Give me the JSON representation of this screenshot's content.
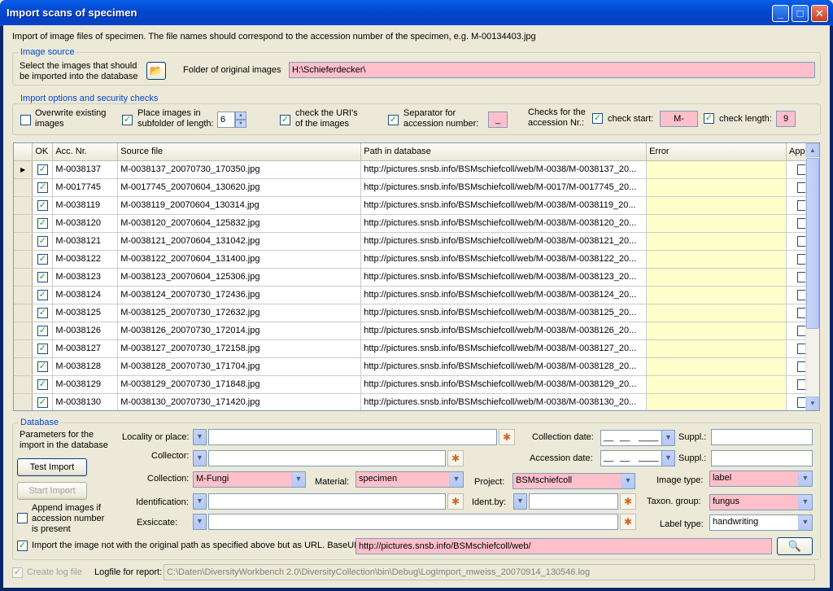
{
  "window": {
    "title": "Import scans of specimen",
    "minimize_glyph": "_",
    "maximize_glyph": "□",
    "close_glyph": "✕"
  },
  "intro": "Import of image files of specimen. The file names should correspond to the accession number of the specimen, e.g. M-00134403.jpg",
  "image_source": {
    "group_title": "Image source",
    "hint_line1": "Select the images that should",
    "hint_line2": "be imported into the database",
    "folder_icon": "folder-open-icon",
    "folder_label": "Folder of original images",
    "folder_value": "H:\\Schieferdecker\\"
  },
  "options": {
    "group_title": "Import options and security checks",
    "overwrite_line1": "Overwrite existing",
    "overwrite_line2": "images",
    "overwrite_checked": false,
    "subfolder_line1": "Place images in",
    "subfolder_line2": "subfolder of length:",
    "subfolder_checked": true,
    "subfolder_length": "6",
    "check_uri_line1": "check the URI's",
    "check_uri_line2": "of the images",
    "check_uri_checked": true,
    "separator_line1": "Separator for",
    "separator_line2": "accession number:",
    "separator_checked": true,
    "separator_value": "_",
    "checks_line1": "Checks for the",
    "checks_line2": "accession Nr.:",
    "check_start_label": "check start:",
    "check_start_checked": true,
    "check_start_value": "M-",
    "check_length_label": "check length:",
    "check_length_checked": true,
    "check_length_value": "9"
  },
  "grid": {
    "columns": [
      "OK",
      "Acc. Nr.",
      "Source file",
      "Path in database",
      "Error",
      "App"
    ],
    "rows": [
      {
        "ok": true,
        "acc": "M-0038137",
        "src": "M-0038137_20070730_170350.jpg",
        "path": "http://pictures.snsb.info/BSMschiefcoll/web/M-0038/M-0038137_20...",
        "error": "",
        "app": false
      },
      {
        "ok": true,
        "acc": "M-0017745",
        "src": "M-0017745_20070604_130620.jpg",
        "path": "http://pictures.snsb.info/BSMschiefcoll/web/M-0017/M-0017745_20...",
        "error": "",
        "app": false
      },
      {
        "ok": true,
        "acc": "M-0038119",
        "src": "M-0038119_20070604_130314.jpg",
        "path": "http://pictures.snsb.info/BSMschiefcoll/web/M-0038/M-0038119_20...",
        "error": "",
        "app": false
      },
      {
        "ok": true,
        "acc": "M-0038120",
        "src": "M-0038120_20070604_125832.jpg",
        "path": "http://pictures.snsb.info/BSMschiefcoll/web/M-0038/M-0038120_20...",
        "error": "",
        "app": false
      },
      {
        "ok": true,
        "acc": "M-0038121",
        "src": "M-0038121_20070604_131042.jpg",
        "path": "http://pictures.snsb.info/BSMschiefcoll/web/M-0038/M-0038121_20...",
        "error": "",
        "app": false
      },
      {
        "ok": true,
        "acc": "M-0038122",
        "src": "M-0038122_20070604_131400.jpg",
        "path": "http://pictures.snsb.info/BSMschiefcoll/web/M-0038/M-0038122_20...",
        "error": "",
        "app": false
      },
      {
        "ok": true,
        "acc": "M-0038123",
        "src": "M-0038123_20070604_125306.jpg",
        "path": "http://pictures.snsb.info/BSMschiefcoll/web/M-0038/M-0038123_20...",
        "error": "",
        "app": false
      },
      {
        "ok": true,
        "acc": "M-0038124",
        "src": "M-0038124_20070730_172436.jpg",
        "path": "http://pictures.snsb.info/BSMschiefcoll/web/M-0038/M-0038124_20...",
        "error": "",
        "app": false
      },
      {
        "ok": true,
        "acc": "M-0038125",
        "src": "M-0038125_20070730_172632.jpg",
        "path": "http://pictures.snsb.info/BSMschiefcoll/web/M-0038/M-0038125_20...",
        "error": "",
        "app": false
      },
      {
        "ok": true,
        "acc": "M-0038126",
        "src": "M-0038126_20070730_172014.jpg",
        "path": "http://pictures.snsb.info/BSMschiefcoll/web/M-0038/M-0038126_20...",
        "error": "",
        "app": false
      },
      {
        "ok": true,
        "acc": "M-0038127",
        "src": "M-0038127_20070730_172158.jpg",
        "path": "http://pictures.snsb.info/BSMschiefcoll/web/M-0038/M-0038127_20...",
        "error": "",
        "app": false
      },
      {
        "ok": true,
        "acc": "M-0038128",
        "src": "M-0038128_20070730_171704.jpg",
        "path": "http://pictures.snsb.info/BSMschiefcoll/web/M-0038/M-0038128_20...",
        "error": "",
        "app": false
      },
      {
        "ok": true,
        "acc": "M-0038129",
        "src": "M-0038129_20070730_171848.jpg",
        "path": "http://pictures.snsb.info/BSMschiefcoll/web/M-0038/M-0038129_20...",
        "error": "",
        "app": false
      },
      {
        "ok": true,
        "acc": "M-0038130",
        "src": "M-0038130_20070730_171420.jpg",
        "path": "http://pictures.snsb.info/BSMschiefcoll/web/M-0038/M-0038130_20...",
        "error": "",
        "app": false
      }
    ]
  },
  "database": {
    "group_title": "Database",
    "params_line1": "Parameters for the",
    "params_line2": "import in the database",
    "test_import": "Test Import",
    "start_import": "Start Import",
    "append_line1": "Append images if",
    "append_line2": "accession number",
    "append_line3": "is present",
    "append_checked": false,
    "locality_label": "Locality or place:",
    "locality_value": "",
    "collector_label": "Collector:",
    "collector_value": "",
    "collection_label": "Collection:",
    "collection_value": "M-Fungi",
    "material_label": "Material:",
    "material_value": "specimen",
    "project_label": "Project:",
    "project_value": "BSMschiefcoll",
    "identification_label": "Identification:",
    "identification_value": "",
    "identby_label": "Ident.by:",
    "identby_value": "",
    "exsiccate_label": "Exsiccate:",
    "exsiccate_value": "",
    "collection_date_label": "Collection date:",
    "accession_date_label": "Accession date:",
    "suppl_label": "Suppl.:",
    "suppl1_value": "",
    "suppl2_value": "",
    "image_type_label": "Image type:",
    "image_type_value": "label",
    "taxon_group_label": "Taxon. group:",
    "taxon_group_value": "fungus",
    "label_type_label": "Label type:",
    "label_type_value": "handwriting",
    "baseurl_checked": true,
    "baseurl_label": "Import the image not with the original path as specified above but as URL. BaseURL",
    "baseurl_value": "http://pictures.snsb.info/BSMschiefcoll/web/",
    "search_icon": "search-icon"
  },
  "log": {
    "create_log_label": "Create log file",
    "create_log_checked": true,
    "logfile_label": "Logfile for report:",
    "logfile_value": "C:\\Daten\\DiversityWorkbench 2.0\\DiversityCollection\\bin\\Debug\\LogImport_mweiss_20070914_130546.log"
  },
  "colors": {
    "required_field": "#ffc0cb",
    "error_cell": "#ffffcc",
    "group_title": "#0046d5"
  }
}
